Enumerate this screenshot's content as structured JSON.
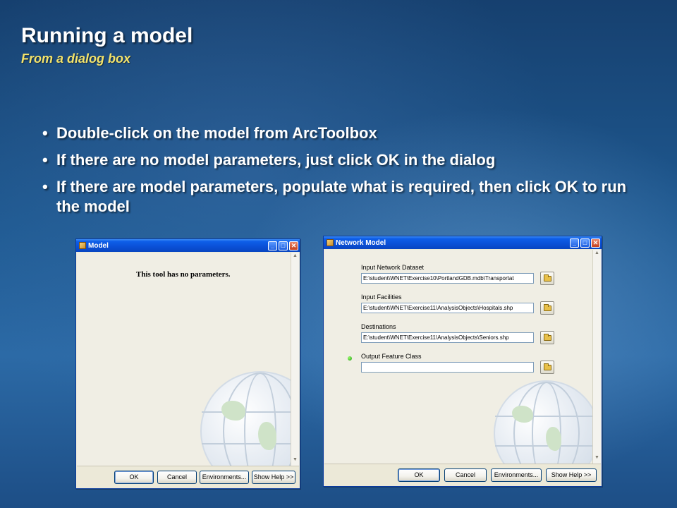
{
  "slide": {
    "title": "Running a model",
    "subtitle": "From a dialog box",
    "bullets": [
      "Double-click on the model from ArcToolbox",
      "If there are no model  parameters, just click OK in the dialog",
      "If there are model parameters, populate what is required, then click OK to run the model"
    ],
    "bullet_glyph": "•"
  },
  "dialog_model": {
    "title": "Model",
    "message": "This tool has no parameters.",
    "buttons": {
      "ok": "OK",
      "cancel": "Cancel",
      "environments": "Environments...",
      "show_help": "Show Help >>"
    }
  },
  "dialog_network": {
    "title": "Network Model",
    "fields": [
      {
        "label": "Input Network Dataset",
        "value": "E:\\student\\WNET\\Exercise10\\PortlandGDB.mdb\\Transportat"
      },
      {
        "label": "Input Facilities",
        "value": "E:\\student\\WNET\\Exercise11\\AnalysisObjects\\Hospitals.shp"
      },
      {
        "label": "Destinations",
        "value": "E:\\student\\WNET\\Exercise11\\AnalysisObjects\\Seniors.shp"
      },
      {
        "label": "Output Feature Class",
        "value": ""
      }
    ],
    "buttons": {
      "ok": "OK",
      "cancel": "Cancel",
      "environments": "Environments...",
      "show_help": "Show Help >>"
    }
  },
  "window_controls": {
    "minimize": "_",
    "maximize": "□",
    "close": "✕"
  },
  "colors": {
    "title_text": "#ffffff",
    "subtitle_text": "#f3e36b",
    "xp_titlebar": "#0a50d6",
    "dialog_face": "#ece9d8"
  }
}
